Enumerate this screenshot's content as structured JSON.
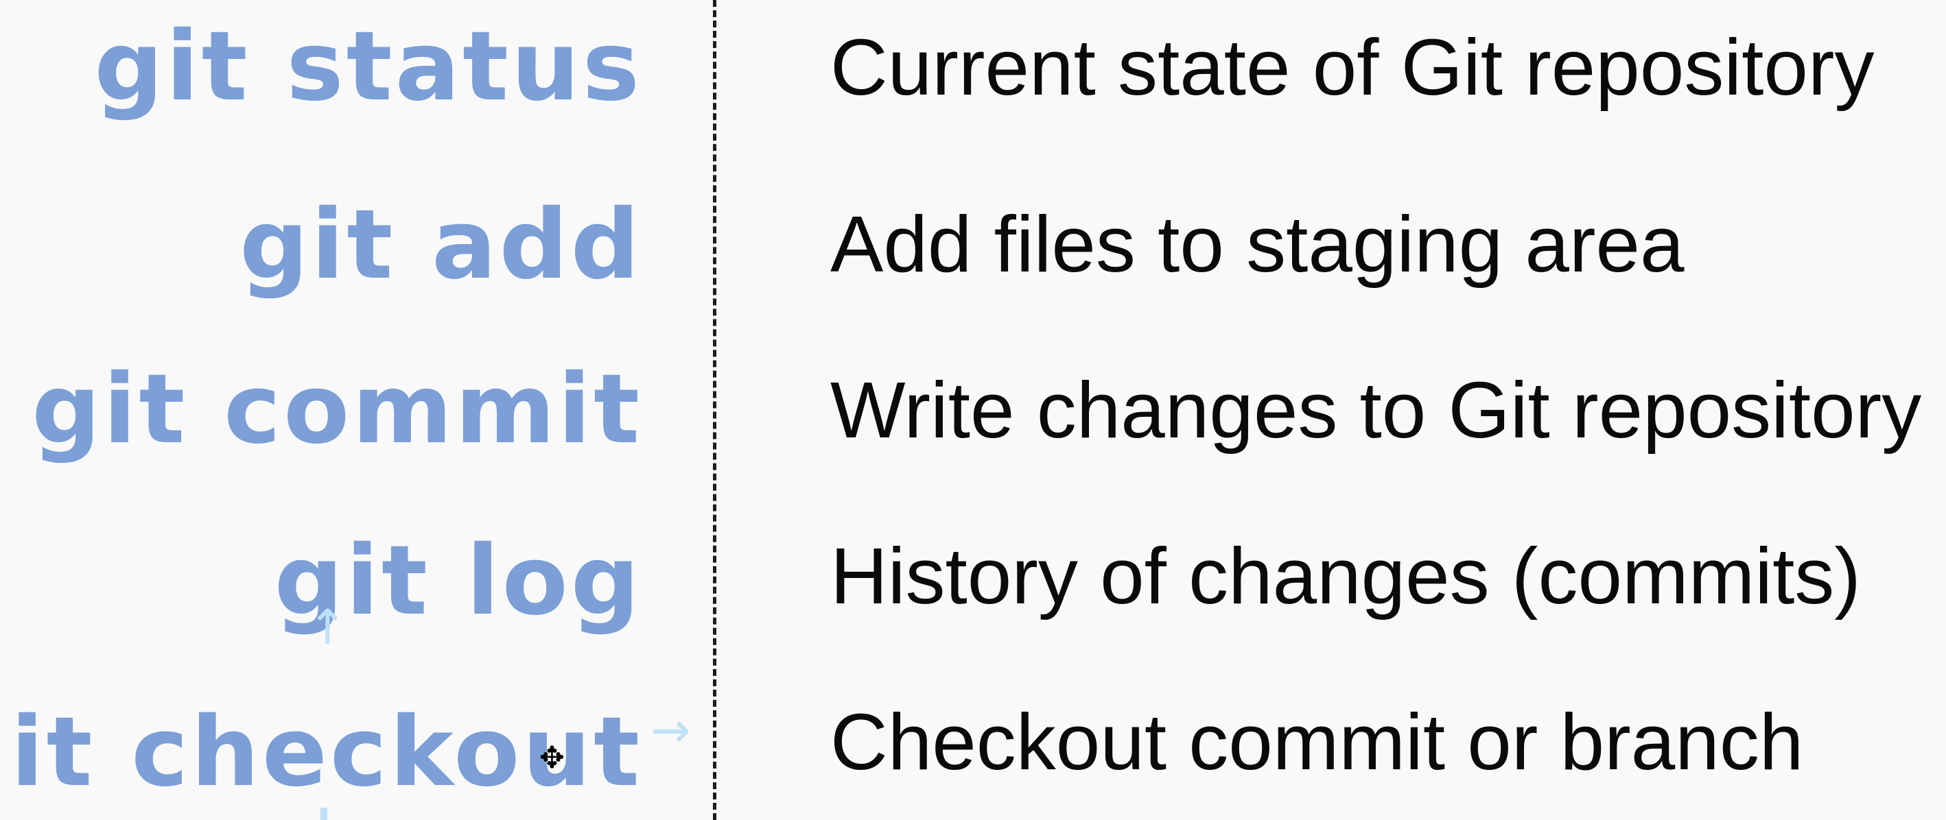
{
  "commands": [
    {
      "command": "git status",
      "description": "Current state of Git repository"
    },
    {
      "command": "git add",
      "description": "Add files to staging area"
    },
    {
      "command": "git commit",
      "description": "Write changes to Git repository"
    },
    {
      "command": "git log",
      "description": "History of changes (commits)"
    },
    {
      "command": "git checkout",
      "description": "Checkout commit or branch"
    }
  ],
  "icons": {
    "cursor": "move-cursor-icon",
    "arrow_up": "arrow-up-icon",
    "arrow_right": "arrow-right-icon"
  },
  "colors": {
    "command_text": "#7b9fd6",
    "description_text": "#0a0a0a",
    "background": "#f9f9f9",
    "divider": "#1c1c1c",
    "faint_arrow": "#bfe0f6"
  }
}
